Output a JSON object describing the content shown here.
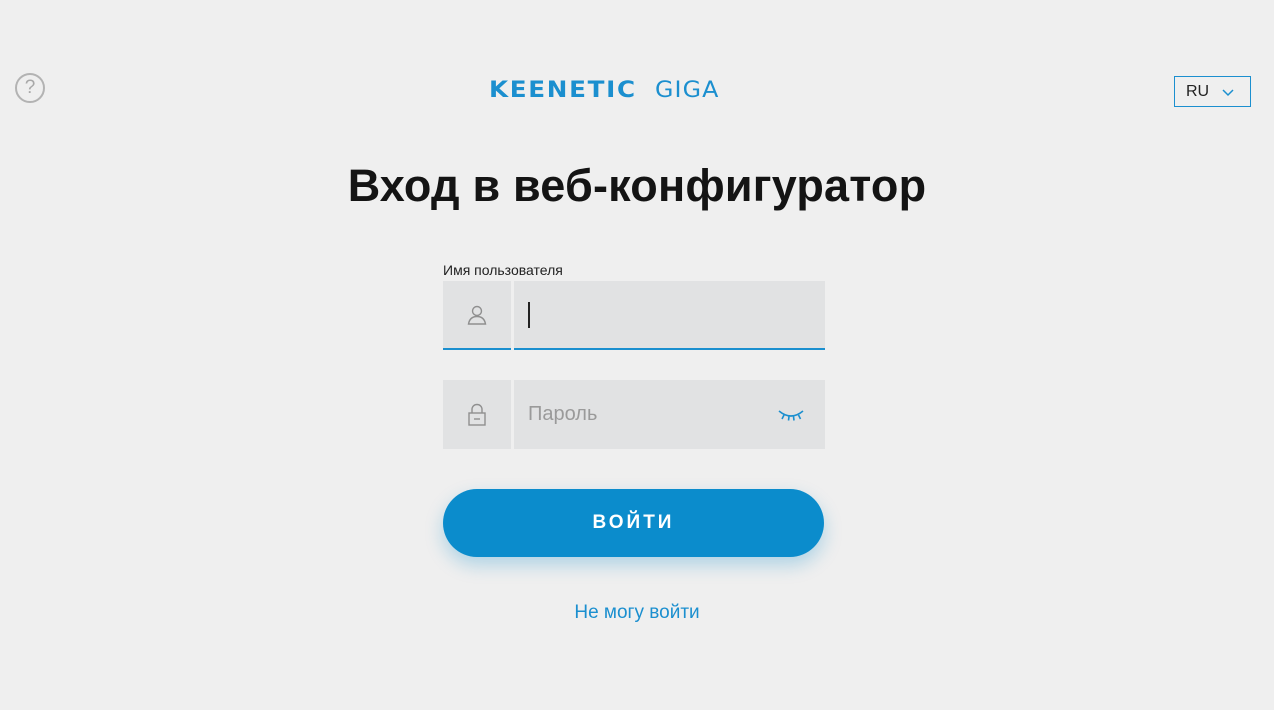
{
  "header": {
    "help_icon": "question-circle-icon",
    "help_glyph": "?",
    "logo_brand": "KEENETIC",
    "logo_model": "GIGA",
    "language": "RU",
    "language_chevron_icon": "chevron-down-icon"
  },
  "main": {
    "title": "Вход в веб-конфигуратор",
    "username": {
      "label": "Имя пользователя",
      "value": "",
      "icon": "user-icon"
    },
    "password": {
      "placeholder": "Пароль",
      "value": "",
      "icon": "lock-icon",
      "toggle_icon": "eye-closed-icon"
    },
    "login_button": "ВОЙТИ",
    "forgot_link": "Не могу войти"
  },
  "colors": {
    "accent": "#1b8fcf",
    "button": "#0b8ccc",
    "background": "#efefef",
    "field_bg": "#e1e2e3"
  }
}
